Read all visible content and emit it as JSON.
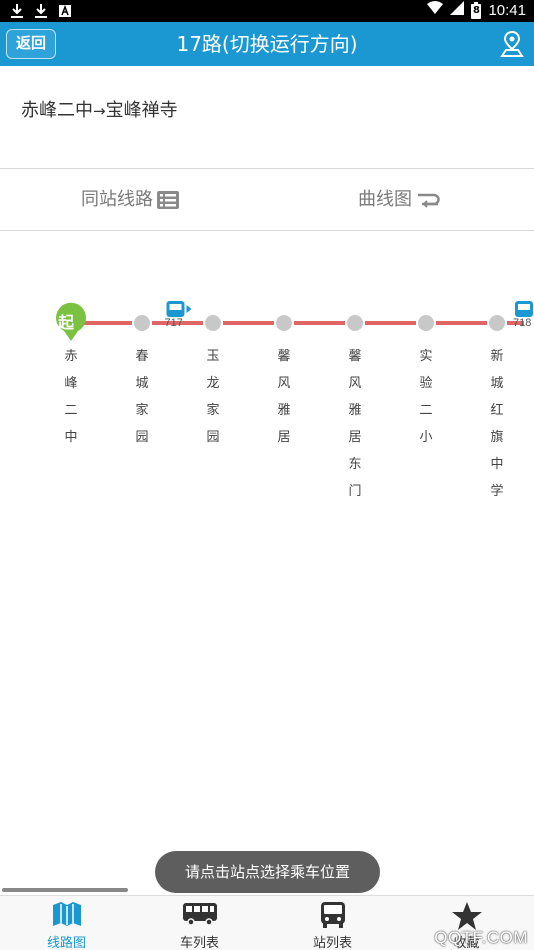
{
  "status_bar": {
    "time": "10:41",
    "battery_text": "8"
  },
  "header": {
    "back_label": "返回",
    "title": "17路(切换运行方向)"
  },
  "route": {
    "from": "赤峰二中",
    "arrow": "→",
    "to": "宝峰禅寺"
  },
  "tabs": [
    {
      "label": "同站线路"
    },
    {
      "label": "曲线图"
    }
  ],
  "line": {
    "start_badge": "起",
    "line_color": "#e06666",
    "stations": [
      {
        "name": [
          "赤",
          "峰",
          "二",
          "中"
        ]
      },
      {
        "name": [
          "春",
          "城",
          "家",
          "园"
        ]
      },
      {
        "name": [
          "玉",
          "龙",
          "家",
          "园"
        ]
      },
      {
        "name": [
          "馨",
          "风",
          "雅",
          "居"
        ]
      },
      {
        "name": [
          "馨",
          "风",
          "雅",
          "居",
          "东",
          "门"
        ]
      },
      {
        "name": [
          "实",
          "验",
          "二",
          "小"
        ]
      },
      {
        "name": [
          "新",
          "城",
          "红",
          "旗",
          "中",
          "学"
        ]
      }
    ],
    "buses": [
      {
        "number": "717"
      },
      {
        "number": "718"
      }
    ]
  },
  "toast": "请点击站点选择乘车位置",
  "bottom_nav": [
    {
      "label": "线路图",
      "icon": "map-book-icon",
      "active": true
    },
    {
      "label": "车列表",
      "icon": "bus-side-icon",
      "active": false
    },
    {
      "label": "站列表",
      "icon": "bus-front-icon",
      "active": false
    },
    {
      "label": "收藏",
      "icon": "star-icon",
      "active": false
    }
  ],
  "watermark": "QQTF.COM",
  "colors": {
    "header": "#1b98d1",
    "start_badge": "#7cc242",
    "station_dot": "#c8c8c8",
    "bus": "#1b98d1"
  }
}
